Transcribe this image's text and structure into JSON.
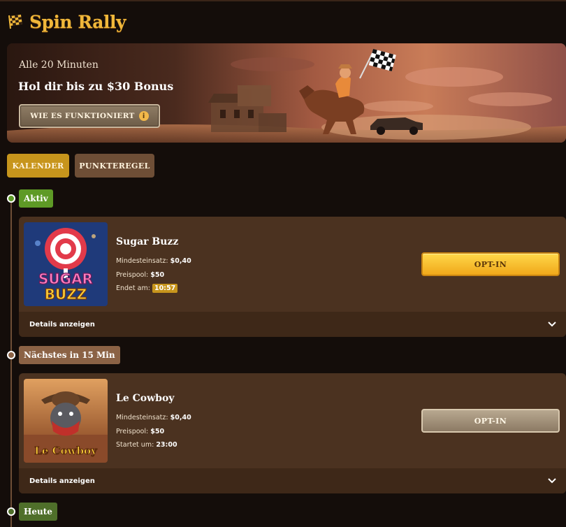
{
  "header": {
    "title": "Spin Rally",
    "icon": "race-flag-icon"
  },
  "banner": {
    "subtitle": "Alle 20 Minuten",
    "title": "Hol dir bis zu $30 Bonus",
    "button_label": "WIE ES FUNKTIONIERT",
    "button_icon": "info-icon"
  },
  "tabs": [
    {
      "label": "KALENDER",
      "active": true
    },
    {
      "label": "PUNKTEREGEL",
      "active": false
    }
  ],
  "sections": [
    {
      "badge": "Aktiv",
      "card": {
        "game": "Sugar Buzz",
        "thumb_text": "SUGAR BUZZ",
        "min_bet_label": "Mindesteinsatz:",
        "min_bet": "$0,40",
        "pool_label": "Preispool:",
        "pool": "$50",
        "time_label": "Endet am:",
        "time": "10:57",
        "button": "OPT-IN",
        "details": "Details anzeigen"
      }
    },
    {
      "badge": "Nächstes in 15 Min",
      "card": {
        "game": "Le Cowboy",
        "thumb_text": "Le Cowboy",
        "min_bet_label": "Mindesteinsatz:",
        "min_bet": "$0,40",
        "pool_label": "Preispool:",
        "pool": "$50",
        "time_label": "Startet um:",
        "time": "23:00",
        "button": "OPT-IN",
        "details": "Details anzeigen"
      }
    },
    {
      "badge": "Heute"
    }
  ],
  "colors": {
    "accent_gold": "#f0b73a",
    "active_green": "#5e9a26",
    "card_bg": "#4b3220",
    "optin_yellow": "#f0a81a"
  }
}
